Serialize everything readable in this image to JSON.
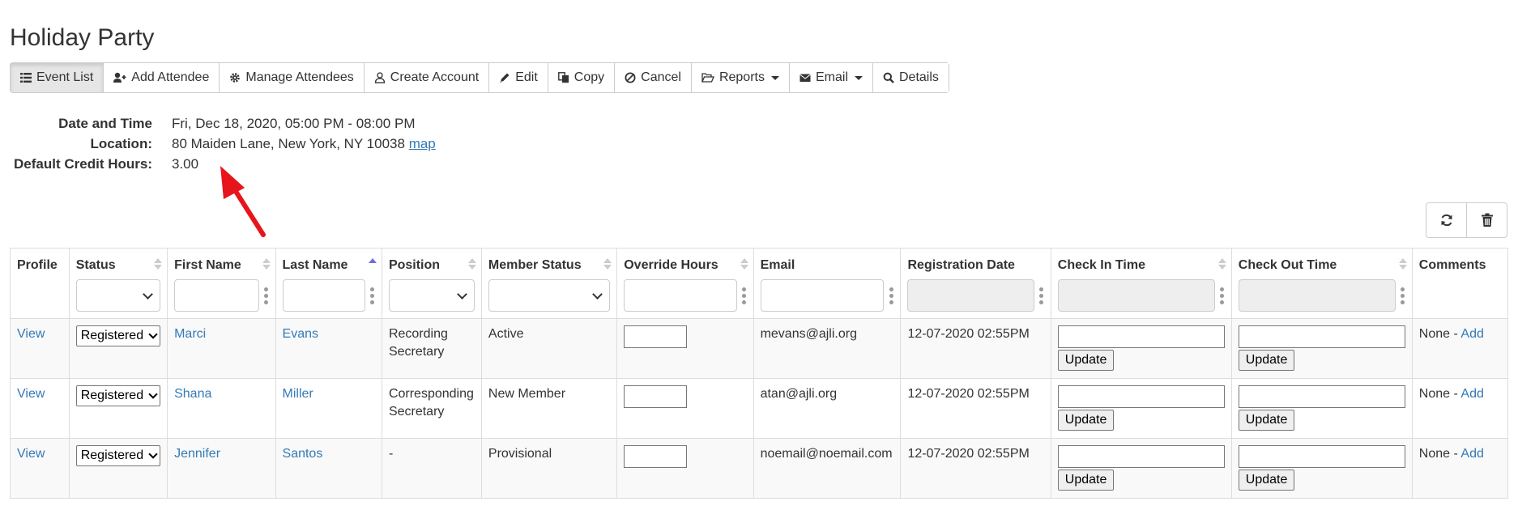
{
  "page": {
    "title": "Holiday Party"
  },
  "toolbar": [
    {
      "label": "Event List",
      "icon": "list-icon",
      "active": true
    },
    {
      "label": "Add Attendee",
      "icon": "user-plus-icon"
    },
    {
      "label": "Manage Attendees",
      "icon": "gear-icon"
    },
    {
      "label": "Create Account",
      "icon": "user-icon"
    },
    {
      "label": "Edit",
      "icon": "pencil-icon"
    },
    {
      "label": "Copy",
      "icon": "copy-icon"
    },
    {
      "label": "Cancel",
      "icon": "ban-icon"
    },
    {
      "label": "Reports",
      "icon": "folder-open-icon",
      "dropdown": true
    },
    {
      "label": "Email",
      "icon": "envelope-icon",
      "dropdown": true
    },
    {
      "label": "Details",
      "icon": "search-icon"
    }
  ],
  "event": {
    "date_label": "Date and Time",
    "date_value": "Fri, Dec 18, 2020, 05:00 PM - 08:00 PM",
    "location_label": "Location:",
    "location_value": "80 Maiden Lane, New York, NY 10038",
    "map_link": "map",
    "credit_label": "Default Credit Hours:",
    "credit_value": "3.00"
  },
  "colors": {
    "link": "#337ab7",
    "annotation_arrow": "#e8141b",
    "stripe": "#f9f9f9"
  },
  "table": {
    "headers": {
      "profile": "Profile",
      "status": "Status",
      "first_name": "First Name",
      "last_name": "Last Name",
      "position": "Position",
      "member_status": "Member Status",
      "override_hours": "Override Hours",
      "email": "Email",
      "registration_date": "Registration Date",
      "check_in": "Check In Time",
      "check_out": "Check Out Time",
      "comments": "Comments"
    },
    "rows": [
      {
        "profile": "View",
        "status": "Registered",
        "first": "Marci",
        "last": "Evans",
        "position": "Recording Secretary",
        "member_status": "Active",
        "email": "mevans@ajli.org",
        "reg_date": "12-07-2020 02:55PM",
        "update_in": "Update",
        "update_out": "Update",
        "comments": "None - ",
        "add": "Add"
      },
      {
        "profile": "View",
        "status": "Registered",
        "first": "Shana",
        "last": "Miller",
        "position": "Corresponding Secretary",
        "member_status": "New Member",
        "email": "atan@ajli.org",
        "reg_date": "12-07-2020 02:55PM",
        "update_in": "Update",
        "update_out": "Update",
        "comments": "None - ",
        "add": "Add"
      },
      {
        "profile": "View",
        "status": "Registered",
        "first": "Jennifer",
        "last": "Santos",
        "position": "-",
        "member_status": "Provisional",
        "email": "noemail@noemail.com",
        "reg_date": "12-07-2020 02:55PM",
        "update_in": "Update",
        "update_out": "Update",
        "comments": "None - ",
        "add": "Add"
      }
    ]
  }
}
